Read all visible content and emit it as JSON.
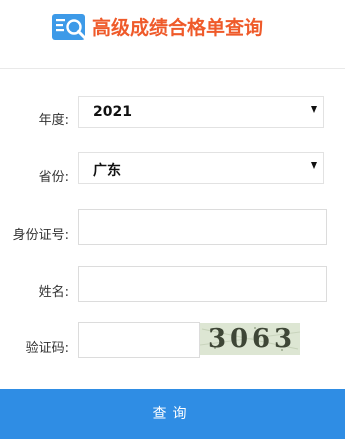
{
  "header": {
    "title": "高级成绩合格单查询"
  },
  "form": {
    "year_label": "年度:",
    "year_value": "2021",
    "province_label": "省份:",
    "province_value": "广东",
    "id_label": "身份证号:",
    "id_value": "",
    "name_label": "姓名:",
    "name_value": "",
    "captcha_label": "验证码:",
    "captcha_value": "",
    "captcha_text": [
      "3",
      "0",
      "6",
      "3"
    ]
  },
  "submit_label": "查询",
  "colors": {
    "title": "#ef5a2a",
    "button": "#2f8de4",
    "logo": "#3d9ae8"
  }
}
